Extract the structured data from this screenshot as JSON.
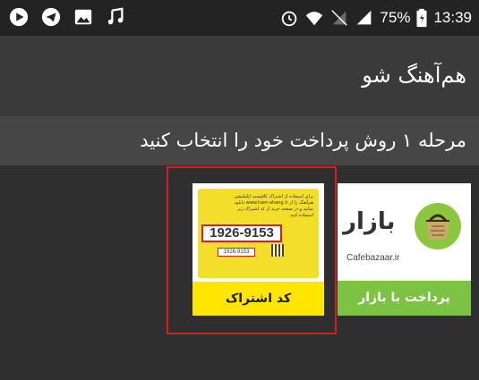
{
  "status_bar": {
    "battery_percent": "75%",
    "time": "13:39",
    "left_icons": [
      "play-icon",
      "telegram-icon",
      "image-icon",
      "music-note-icon"
    ],
    "right_icons": [
      "alarm-icon",
      "wifi-icon",
      "no-signal-icon",
      "signal-icon",
      "battery-icon"
    ]
  },
  "app": {
    "title": "هم‌آهنگ شو"
  },
  "step": {
    "title": "مرحله ۱ روش پرداخت خود را انتخاب کنید"
  },
  "options": {
    "subscription_code": {
      "label": "کد اشتراک",
      "card_text": "برای استفاده از اشتراک کافیست اپلیکیشن هم‌آهنگ را از www.ham-ahang.ir دانلود نمایید و در صفحه خرید از کد اشتراک زیر استفاده کنید",
      "code_large": "1926-9153",
      "code_small": "1926-9153",
      "selected": true
    },
    "bazaar": {
      "label": "پرداخت با بازار",
      "brand_word": "بازار",
      "brand_site": "Cafebazaar.ir"
    }
  },
  "colors": {
    "status_bar": "#232323",
    "app_bar": "#3a3a3a",
    "step_bar": "#464646",
    "selection_border": "#d21f1f",
    "subscription_yellow": "#ffe500",
    "bazaar_green": "#7cc243"
  }
}
